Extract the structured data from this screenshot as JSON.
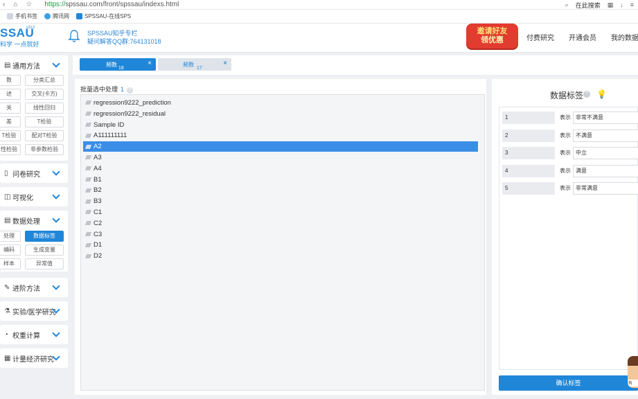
{
  "browser": {
    "url_protocol": "https://",
    "url_rest": "spssau.com/front/spssau/indexs.html",
    "search_hint": "在此搜索",
    "bookmarks": [
      "手机书签",
      "腾讯网",
      "SPSSAU-在线SPS"
    ]
  },
  "header": {
    "brand": "SSAU",
    "version": "v22.0",
    "slogan": "科学 一点就好",
    "notice_line1": "SPSSAU知乎专栏",
    "notice_line2": "疑问解答QQ群:764131018",
    "promo_line1": "邀请好友",
    "promo_line2": "领优惠",
    "nav": [
      "付费研究",
      "开通会员",
      "我的数据"
    ]
  },
  "sidebar": {
    "general": {
      "title": "通用方法",
      "buttons": [
        "数",
        "分类汇总",
        "述",
        "交叉(卡方)",
        "关",
        "线性回归",
        "差",
        "T检验",
        "T检验",
        "配对T检验",
        "性检验",
        "非参数检验"
      ]
    },
    "survey": "问卷研究",
    "visual": "可视化",
    "data": {
      "title": "数据处理",
      "buttons": [
        "处理",
        "数据标签",
        "编码",
        "生成变量",
        "样本",
        "异常值"
      ]
    },
    "advanced": "进阶方法",
    "medical": "实验/医学研究",
    "weight": "权重计算",
    "econ": "计量经济研究"
  },
  "tabs": [
    {
      "label": "频数",
      "count": "18",
      "close": "×"
    },
    {
      "label": "频数",
      "count": "17",
      "close": "×"
    }
  ],
  "main": {
    "title": "批量选中处理",
    "count": "1",
    "help": "?",
    "variables": [
      "regression9222_prediction",
      "regression9222_residual",
      "Sample ID",
      "A111111111",
      "A2",
      "A3",
      "A4",
      "B1",
      "B2",
      "B3",
      "C1",
      "C2",
      "C3",
      "D1",
      "D2"
    ],
    "selected": "A2"
  },
  "labels_panel": {
    "title": "数据标签",
    "help": "?",
    "rows": [
      {
        "num": "1",
        "show": "表示",
        "value": "非常不满意"
      },
      {
        "num": "2",
        "show": "表示",
        "value": "不满意"
      },
      {
        "num": "3",
        "show": "表示",
        "value": "中立"
      },
      {
        "num": "4",
        "show": "表示",
        "value": "满意"
      },
      {
        "num": "5",
        "show": "表示",
        "value": "非常满意"
      }
    ],
    "confirm": "确认标签"
  },
  "mascot_badge": "有"
}
